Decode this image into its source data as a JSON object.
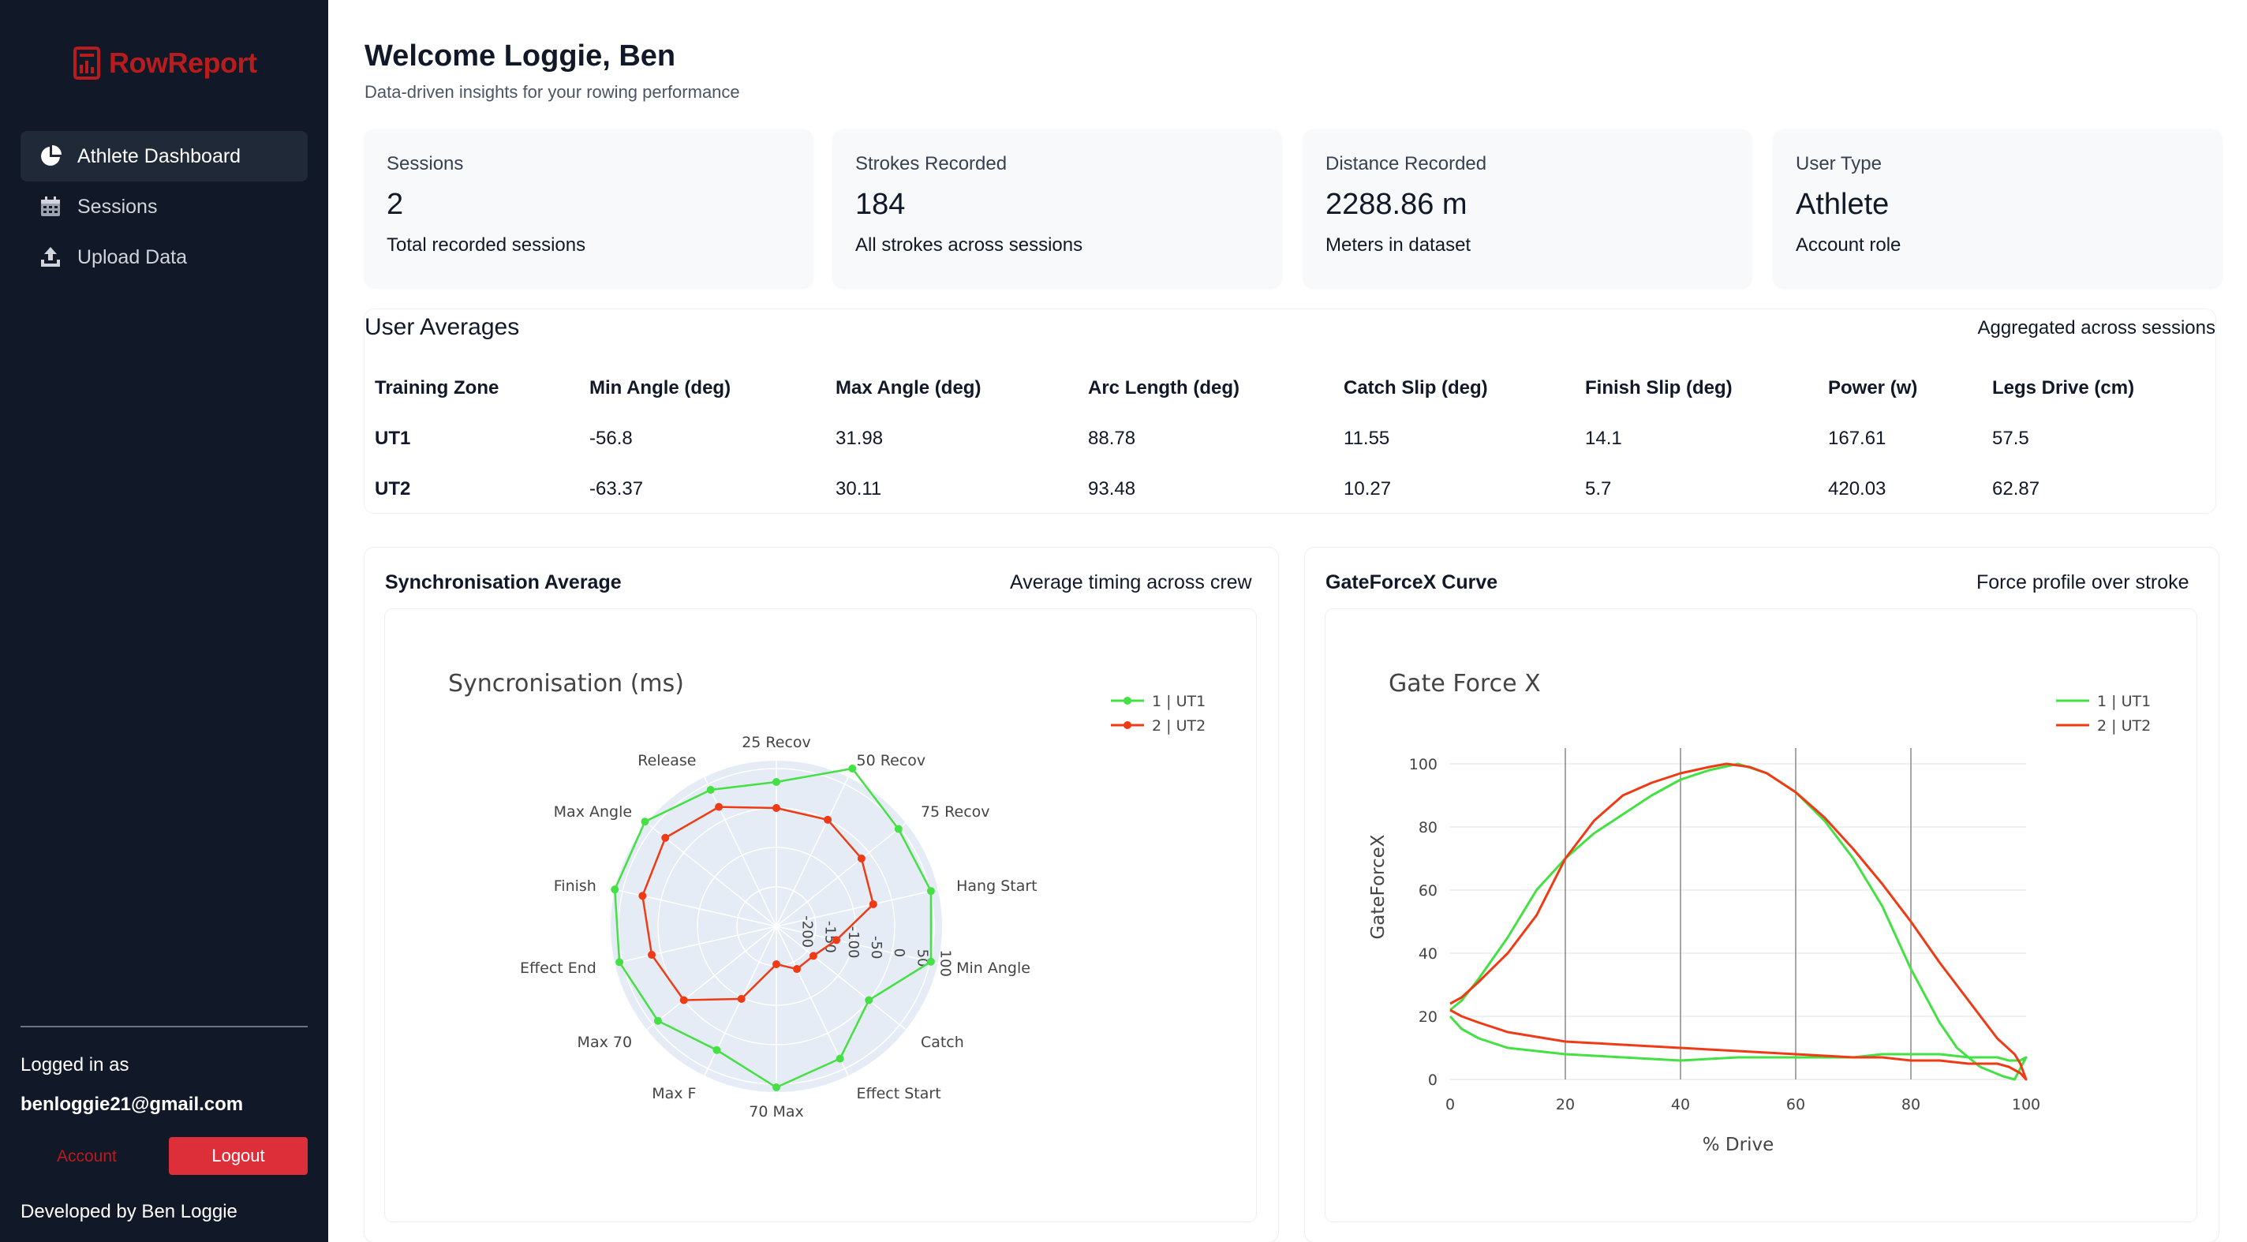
{
  "brand": {
    "name": "RowReport"
  },
  "sidebar": {
    "items": [
      {
        "label": "Athlete Dashboard",
        "icon": "pie-chart-icon",
        "active": true
      },
      {
        "label": "Sessions",
        "icon": "calendar-icon",
        "active": false
      },
      {
        "label": "Upload Data",
        "icon": "upload-icon",
        "active": false
      }
    ],
    "logged_in_label": "Logged in as",
    "email": "benloggie21@gmail.com",
    "account_label": "Account",
    "logout_label": "Logout",
    "developed_by": "Developed by Ben Loggie"
  },
  "header": {
    "title": "Welcome Loggie, Ben",
    "subtitle": "Data-driven insights for your rowing performance"
  },
  "stats": [
    {
      "label": "Sessions",
      "value": "2",
      "desc": "Total recorded sessions"
    },
    {
      "label": "Strokes Recorded",
      "value": "184",
      "desc": "All strokes across sessions"
    },
    {
      "label": "Distance Recorded",
      "value": "2288.86 m",
      "desc": "Meters in dataset"
    },
    {
      "label": "User Type",
      "value": "Athlete",
      "desc": "Account role"
    }
  ],
  "averages": {
    "title": "User Averages",
    "subtitle": "Aggregated across sessions",
    "columns": [
      "Training Zone",
      "Min Angle (deg)",
      "Max Angle (deg)",
      "Arc Length (deg)",
      "Catch Slip (deg)",
      "Finish Slip (deg)",
      "Power (w)",
      "Legs Drive (cm)"
    ],
    "rows": [
      [
        "UT1",
        "-56.8",
        "31.98",
        "88.78",
        "11.55",
        "14.1",
        "167.61",
        "57.5"
      ],
      [
        "UT2",
        "-63.37",
        "30.11",
        "93.48",
        "10.27",
        "5.7",
        "420.03",
        "62.87"
      ]
    ]
  },
  "sync_card": {
    "title": "Synchronisation Average",
    "subtitle": "Average timing across crew"
  },
  "force_card": {
    "title": "GateForceX Curve",
    "subtitle": "Force profile over stroke"
  },
  "colors": {
    "ut1": "#44e044",
    "ut2": "#ee3b16",
    "brand": "#b91c1c",
    "sidebar_bg": "#111827",
    "logout": "#dc2f3a"
  },
  "chart_data": [
    {
      "type": "radar",
      "title": "Syncronisation (ms)",
      "axes": [
        "25 Recov",
        "50 Recov",
        "75 Recov",
        "Hang Start",
        "Min Angle",
        "Catch",
        "Effect Start",
        "70 Max",
        "Max F",
        "Max 70",
        "Effect End",
        "Finish",
        "Max Angle",
        "Release"
      ],
      "radial_range": [
        -250,
        100
      ],
      "radial_ticks": [
        "-200",
        "-150",
        "-100",
        "-50",
        "0",
        "50",
        "100"
      ],
      "legend": "top-right",
      "series": [
        {
          "name": "1 | UT1",
          "values": [
            55,
            120,
            80,
            85,
            85,
            0,
            60,
            90,
            40,
            70,
            90,
            100,
            105,
            70
          ]
        },
        {
          "name": "2 | UT2",
          "values": [
            0,
            0,
            -20,
            -40,
            -120,
            -150,
            -150,
            -170,
            -80,
            0,
            20,
            40,
            50,
            30
          ]
        }
      ]
    },
    {
      "type": "line",
      "title": "Gate Force X",
      "xlabel": "% Drive",
      "ylabel": "GateForceX",
      "xlim": [
        0,
        100
      ],
      "ylim": [
        0,
        105
      ],
      "xticks": [
        "0",
        "20",
        "40",
        "60",
        "80",
        "100"
      ],
      "yticks": [
        "0",
        "20",
        "40",
        "60",
        "80",
        "100"
      ],
      "legend": "top-right",
      "series": [
        {
          "name": "1 | UT1",
          "x": [
            0,
            2,
            5,
            10,
            15,
            20,
            25,
            30,
            35,
            40,
            45,
            50,
            55,
            60,
            65,
            70,
            75,
            80,
            85,
            88,
            92,
            96,
            98,
            100,
            99,
            97,
            95,
            90,
            85,
            80,
            75,
            70,
            60,
            50,
            40,
            30,
            20,
            10,
            5,
            2,
            0
          ],
          "y": [
            22,
            25,
            32,
            45,
            60,
            70,
            78,
            84,
            90,
            95,
            98,
            100,
            97,
            91,
            82,
            70,
            55,
            35,
            18,
            10,
            4,
            1,
            0,
            7,
            6,
            6,
            7,
            7,
            8,
            8,
            8,
            7,
            7,
            7,
            6,
            7,
            8,
            10,
            13,
            16,
            20
          ]
        },
        {
          "name": "2 | UT2",
          "x": [
            0,
            2,
            5,
            10,
            15,
            20,
            25,
            30,
            35,
            40,
            45,
            48,
            52,
            55,
            60,
            65,
            70,
            75,
            80,
            85,
            90,
            95,
            98,
            99,
            100,
            99,
            97,
            95,
            90,
            85,
            80,
            75,
            70,
            60,
            50,
            40,
            30,
            20,
            10,
            5,
            2,
            0
          ],
          "y": [
            24,
            26,
            31,
            40,
            52,
            70,
            82,
            90,
            94,
            97,
            99,
            100,
            99,
            97,
            91,
            83,
            73,
            62,
            50,
            37,
            25,
            13,
            8,
            5,
            0,
            2,
            4,
            5,
            5,
            6,
            6,
            7,
            7,
            8,
            9,
            10,
            11,
            12,
            15,
            18,
            20,
            22
          ]
        }
      ]
    }
  ]
}
